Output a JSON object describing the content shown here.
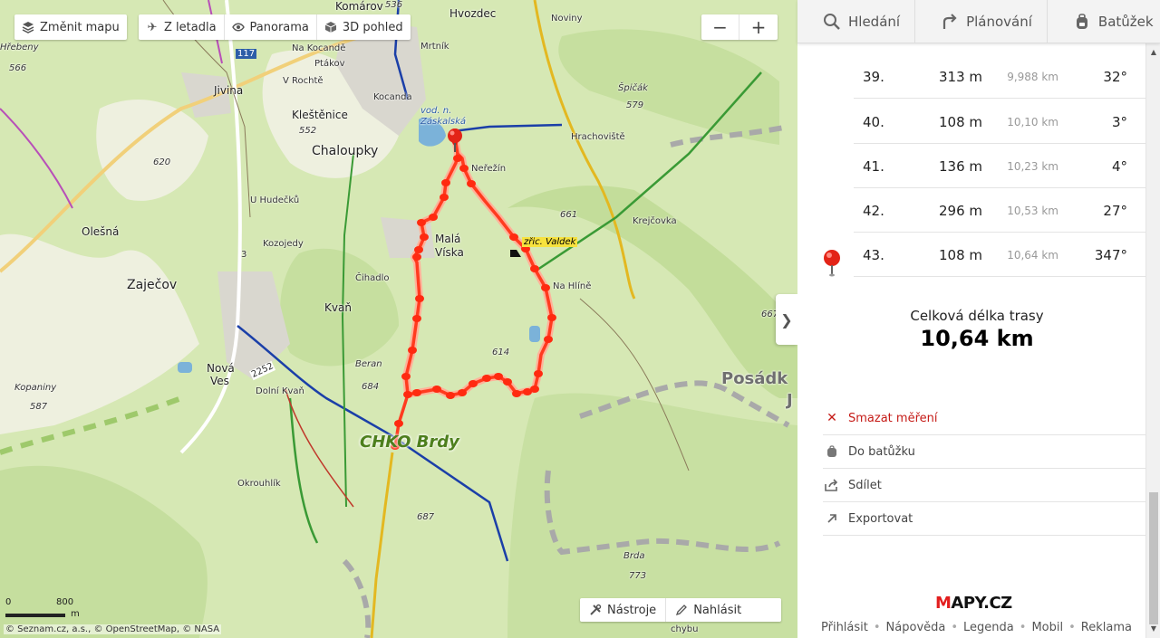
{
  "map": {
    "toolbar": [
      {
        "label": "Změnit mapu",
        "icon": "layers-icon"
      },
      {
        "label": "Z letadla",
        "icon": "airplane-icon"
      },
      {
        "label": "Panorama",
        "icon": "eye-icon"
      },
      {
        "label": "3D pohled",
        "icon": "cube-icon"
      }
    ],
    "zoom_out": "−",
    "zoom_in": "+",
    "bottom_tools": [
      {
        "label": "Nástroje",
        "icon": "tools-icon"
      },
      {
        "label": "Nahlásit",
        "icon": "pencil-icon"
      }
    ],
    "scale_zero": "0",
    "scale_max": "800",
    "scale_unit": "m",
    "copyright": "© Seznam.cz, a.s., © OpenStreetMap, © NASA",
    "collapse": "❯",
    "labels": {
      "hrebeny": "Hřebeny",
      "h566": "566",
      "jivina": "Jivina",
      "road117": "117",
      "komarov": "Komárov",
      "na_kocande": "Na Kocandě",
      "ptakov": "Ptákov",
      "v_rochte": "V Rochtě",
      "kocanda": "Kocanda",
      "mrtnik": "Mrtník",
      "hvozdec": "Hvozdec",
      "noviny": "Noviny",
      "h536": "536",
      "vod_n": "vod. n.",
      "zaskalska": "Záskalská",
      "spicak": "Špičák",
      "h579": "579",
      "hrachoviste": "Hrachoviště",
      "klestenice": "Kleštěnice",
      "h552": "552",
      "chaloupky": "Chaloupky",
      "nerezin": "Neřežín",
      "h620": "620",
      "olesna": "Olešná",
      "u_hudecku": "U Hudečků",
      "kozojedy": "Kozojedy",
      "mala": "Malá",
      "viska": "Víska",
      "h661": "661",
      "krejcovka": "Krejčovka",
      "zric_valdek": "zřic. Valdek",
      "zajecov": "Zaječov",
      "cihadlo": "Čihadlo",
      "na_hline": "Na Hlíně",
      "kvan": "Kvaň",
      "h614": "614",
      "h667": "667",
      "nova": "Nová",
      "ves": "Ves",
      "road2252": "2252",
      "dolni_kvan": "Dolní Kvaň",
      "beran": "Beran",
      "h684": "684",
      "posadka": "Posádk",
      "posadka2": "J",
      "kopaniny": "Kopaniny",
      "h587": "587",
      "chko": "CHKO Brdy",
      "okrouhlik": "Okrouhlík",
      "h687": "687",
      "brda": "Brda",
      "h773": "773",
      "chybu": "chybu",
      "road3": "3"
    }
  },
  "panel": {
    "nav": [
      {
        "label": "Hledání",
        "icon": "search-icon"
      },
      {
        "label": "Plánování",
        "icon": "route-icon"
      },
      {
        "label": "Batůžek",
        "icon": "backpack-icon"
      }
    ],
    "segments": [
      {
        "index": "39.",
        "length": "313 m",
        "cumulative": "9,988 km",
        "angle": "32°"
      },
      {
        "index": "40.",
        "length": "108 m",
        "cumulative": "10,10 km",
        "angle": "3°"
      },
      {
        "index": "41.",
        "length": "136 m",
        "cumulative": "10,23 km",
        "angle": "4°"
      },
      {
        "index": "42.",
        "length": "296 m",
        "cumulative": "10,53 km",
        "angle": "27°"
      },
      {
        "index": "43.",
        "length": "108 m",
        "cumulative": "10,64 km",
        "angle": "347°"
      }
    ],
    "total_label": "Celková délka trasy",
    "total_value": "10,64 km",
    "actions": [
      {
        "label": "Smazat měření",
        "icon": "close-icon"
      },
      {
        "label": "Do batůžku",
        "icon": "backpack-icon"
      },
      {
        "label": "Sdílet",
        "icon": "share-icon"
      },
      {
        "label": "Exportovat",
        "icon": "export-icon"
      }
    ],
    "logo_m": "M",
    "logo_rest": "APY.CZ",
    "footer": [
      "Přihlásit",
      "Nápověda",
      "Legenda",
      "Mobil",
      "Reklama"
    ]
  },
  "colors": {
    "route": "#ff3b1f",
    "accent": "#e21e1e",
    "map_bg": "#d6e8b4"
  }
}
